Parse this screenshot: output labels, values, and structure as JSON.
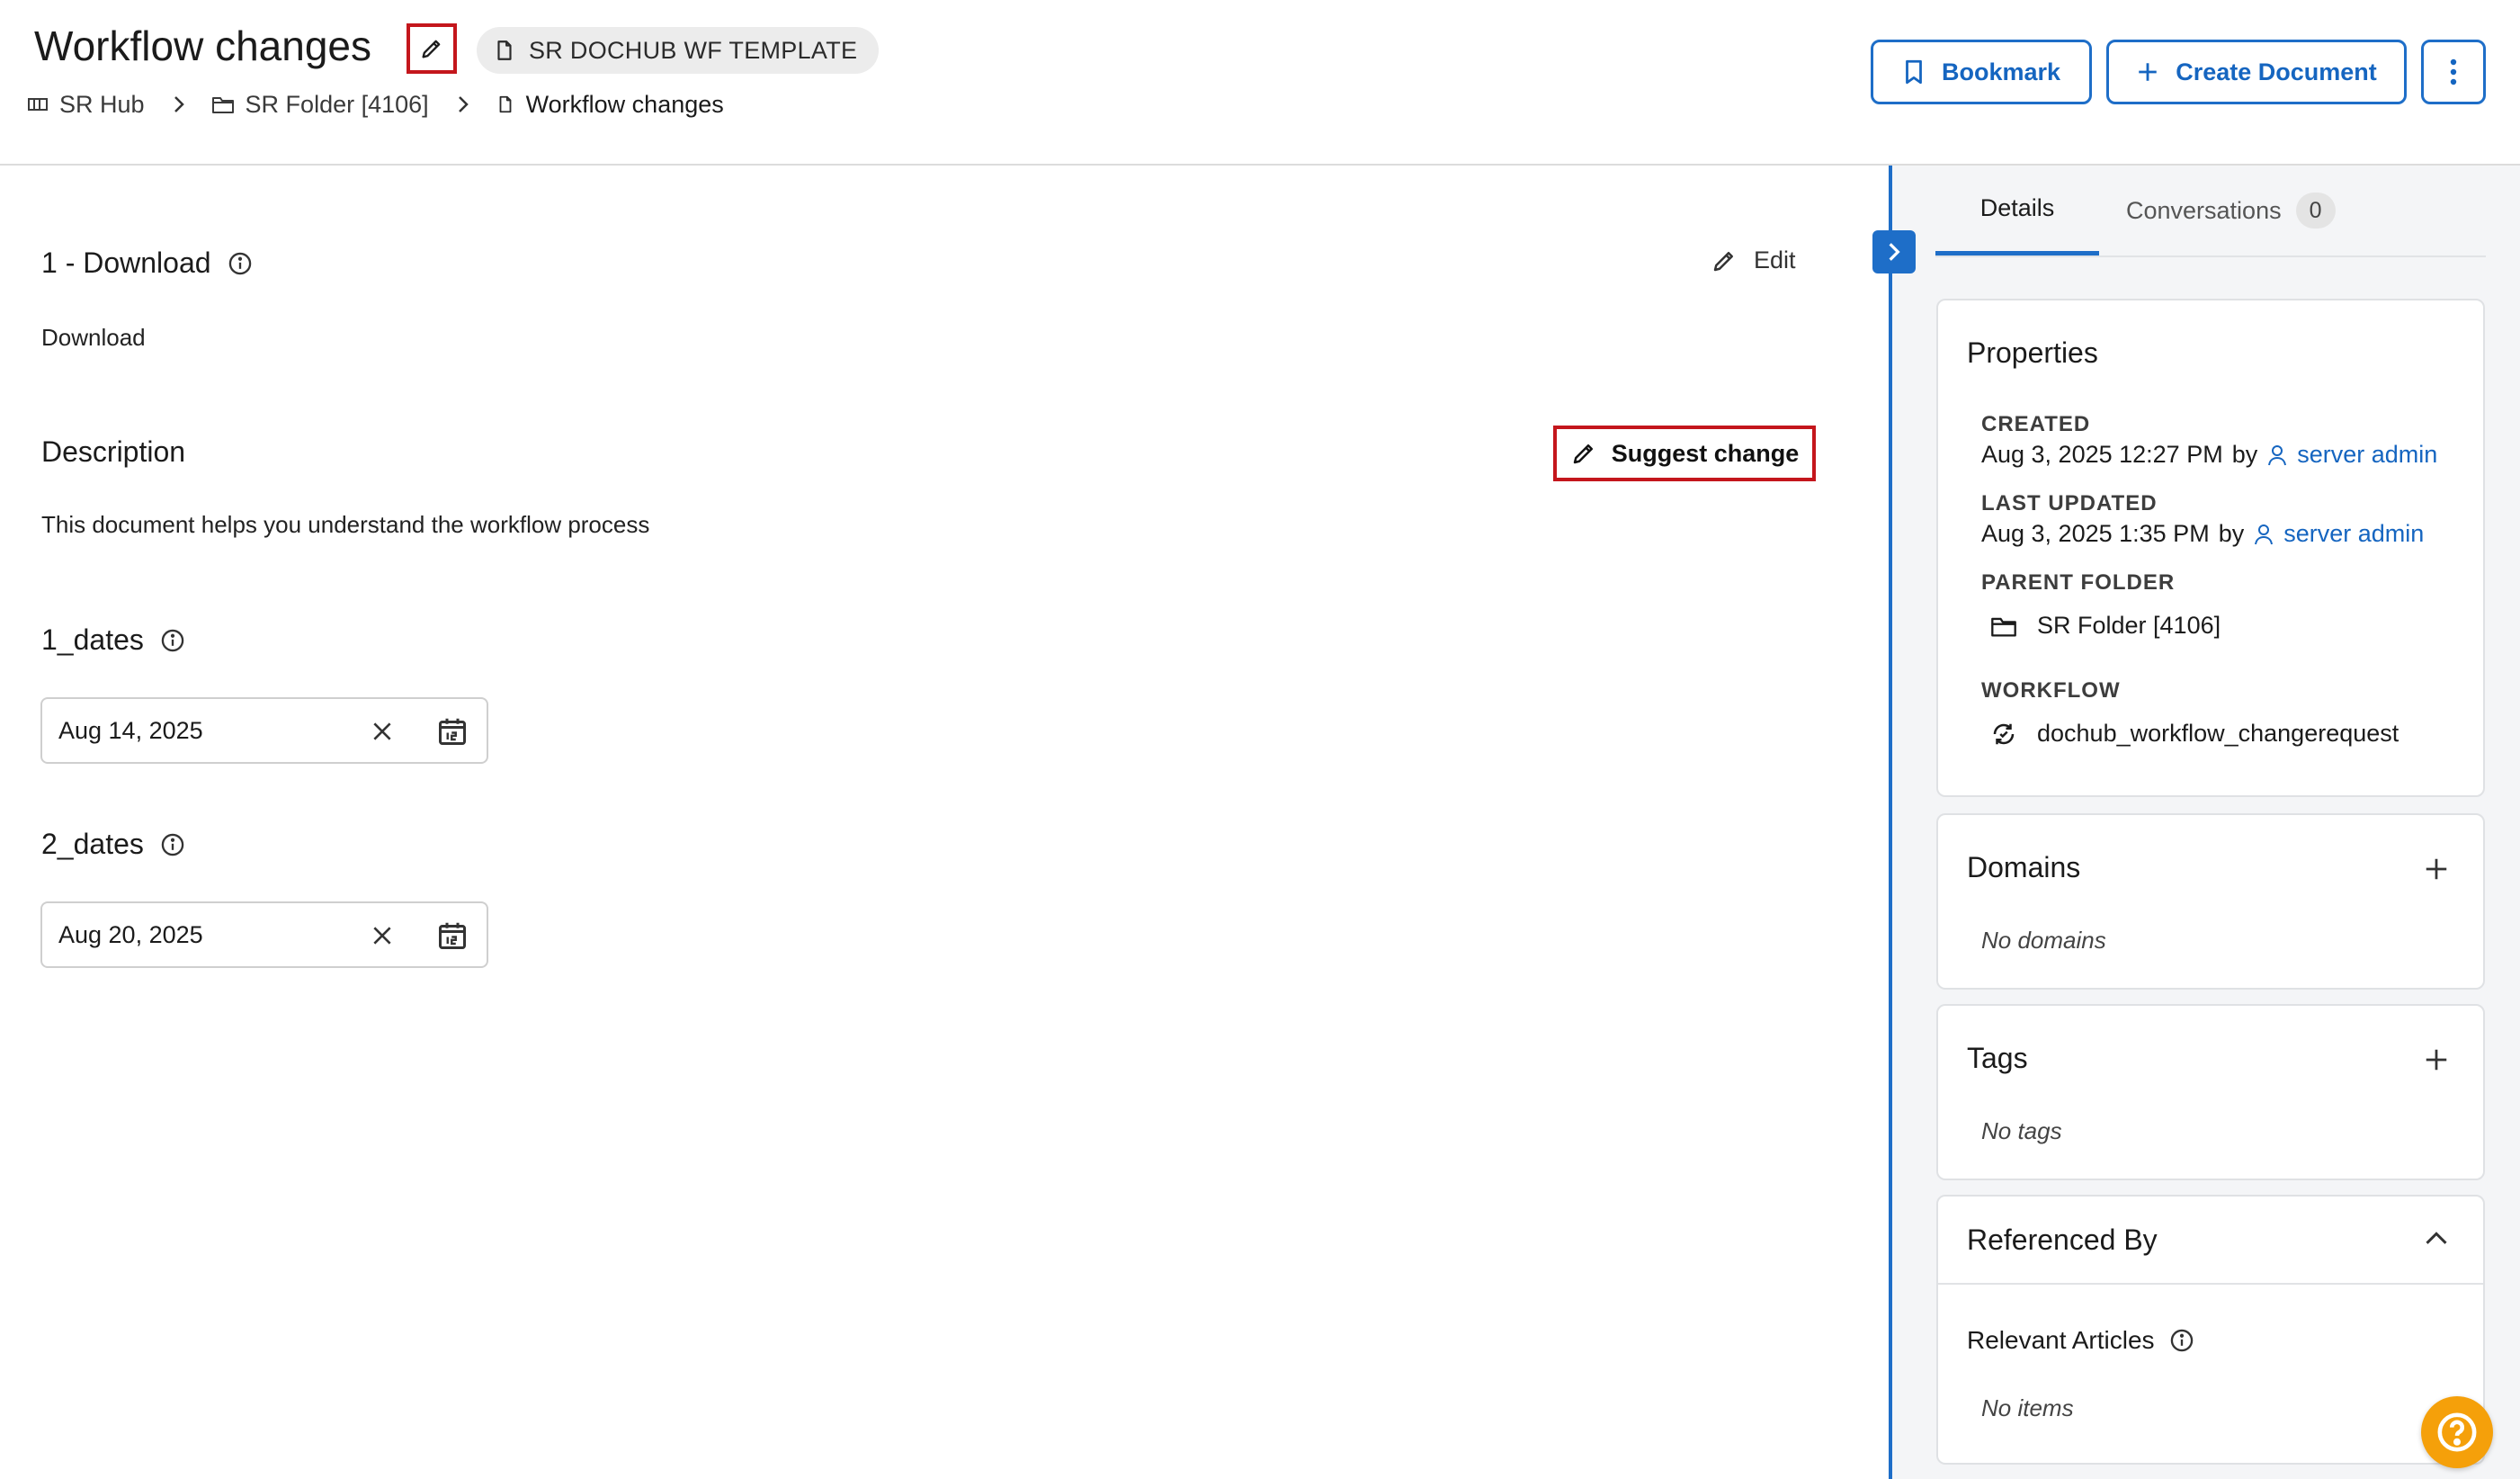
{
  "header": {
    "title": "Workflow changes",
    "template_chip": "SR DOCHUB WF TEMPLATE",
    "breadcrumb": [
      {
        "label": "SR Hub",
        "icon": "hub-icon"
      },
      {
        "label": "SR Folder [4106]",
        "icon": "folder-icon"
      },
      {
        "label": "Workflow changes",
        "icon": "document-icon"
      }
    ],
    "bookmark_label": "Bookmark",
    "create_document_label": "Create Document"
  },
  "main": {
    "download_section": {
      "title": "1 - Download",
      "value": "Download",
      "edit_label": "Edit"
    },
    "description_section": {
      "title": "Description",
      "suggest_change_label": "Suggest change",
      "text": "This document helps you understand the workflow process"
    },
    "dates_1": {
      "title": "1_dates",
      "value": "Aug 14, 2025"
    },
    "dates_2": {
      "title": "2_dates",
      "value": "Aug 20, 2025"
    }
  },
  "side_panel": {
    "tabs": [
      {
        "label": "Details",
        "active": true
      },
      {
        "label": "Conversations",
        "count": "0",
        "active": false
      }
    ],
    "properties": {
      "title": "Properties",
      "created_label": "CREATED",
      "created_value": "Aug 3, 2025 12:27 PM",
      "created_by_word": "by",
      "created_by": "server admin",
      "updated_label": "LAST UPDATED",
      "updated_value": "Aug 3, 2025 1:35 PM",
      "updated_by_word": "by",
      "updated_by": "server admin",
      "parent_folder_label": "PARENT FOLDER",
      "parent_folder_value": "SR Folder [4106]",
      "workflow_label": "WORKFLOW",
      "workflow_value": "dochub_workflow_changerequest"
    },
    "domains": {
      "title": "Domains",
      "empty": "No domains"
    },
    "tags": {
      "title": "Tags",
      "empty": "No tags"
    },
    "referenced_by": {
      "title": "Referenced By",
      "subsection_title": "Relevant Articles",
      "empty": "No items"
    }
  },
  "colors": {
    "accent": "#1e6ec8",
    "highlight_border": "#c4161c",
    "help_button": "#f5a00a",
    "panel_background": "#f4f5f7"
  }
}
